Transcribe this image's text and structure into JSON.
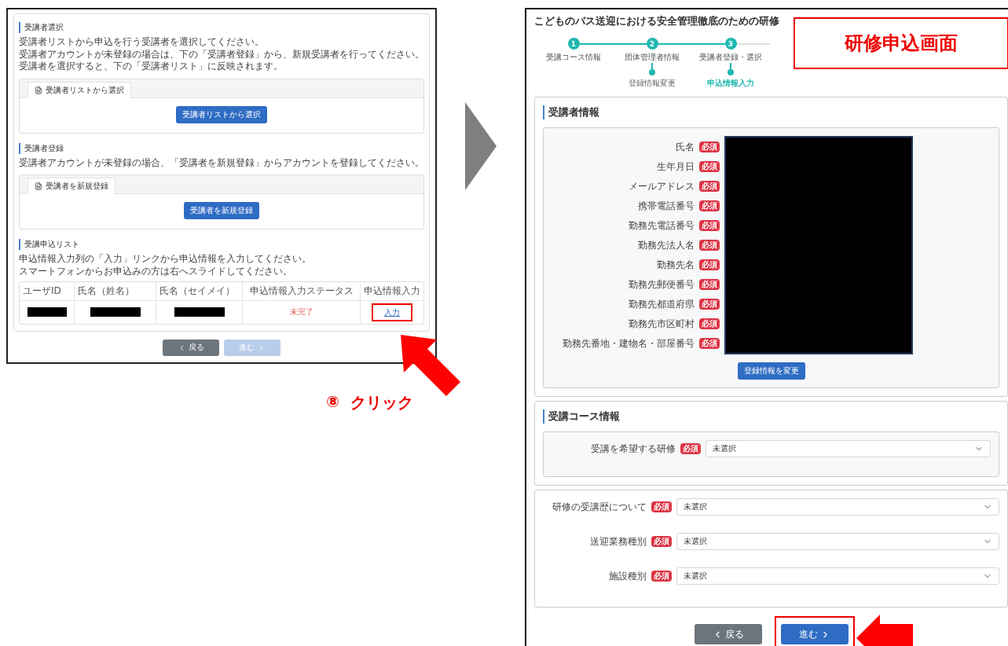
{
  "left_screen": {
    "sections": [
      {
        "heading": "受講者選択",
        "description": [
          "受講者リストから申込を行う受講者を選択してください。",
          "受講者アカウントが未登録の場合は、下の「受講者登録」から、新規受講者を行ってください。",
          "受講者を選択すると、下の「受講者リスト」に反映されます。"
        ],
        "tab": "受講者リストから選択",
        "button": "受講者リストから選択"
      },
      {
        "heading": "受講者登録",
        "description": [
          "受講者アカウントが未登録の場合、「受講者を新規登録」からアカウントを登録してください。"
        ],
        "tab": "受講者を新規登録",
        "button": "受講者を新規登録"
      }
    ],
    "list": {
      "heading": "受講申込リスト",
      "description": [
        "申込情報入力列の「入力」リンクから申込情報を入力してください。",
        "スマートフォンからお申込みの方は右へスライドしてください。"
      ],
      "columns": [
        "ユーザID",
        "氏名（姓名）",
        "氏名（セイメイ）",
        "申込情報入力ステータス",
        "申込情報入力"
      ],
      "rows": [
        {
          "status": "未完了",
          "link": "入力",
          "highlighted": true
        }
      ]
    },
    "buttons": [
      {
        "label": "戻る",
        "kind": "back",
        "disabled": false
      },
      {
        "label": "進む",
        "kind": "next",
        "disabled": true
      }
    ]
  },
  "annotation": {
    "step": "⑧",
    "action": "クリック"
  },
  "right_screen": {
    "title": "こどものバス送迎における安全管理徹底のための研修",
    "steps": [
      {
        "number": "1",
        "label": "受講コース情報",
        "done": true
      },
      {
        "number": "2",
        "label": "団体管理者情報",
        "done": true,
        "sub": {
          "label": "登録情報変更",
          "selected": false
        }
      },
      {
        "number": "3",
        "label": "受講者登録・選択",
        "done": true,
        "sub": {
          "label": "申込情報入力",
          "selected": true
        }
      }
    ],
    "caption": "研修申込画面",
    "applicant": {
      "heading": "受講者情報",
      "fields": [
        {
          "label": "氏名",
          "badge": "必須"
        },
        {
          "label": "生年月日",
          "badge": "必須"
        },
        {
          "label": "メールアドレス",
          "badge": "必須"
        },
        {
          "label": "携帯電話番号",
          "badge": "必須"
        },
        {
          "label": "勤務先電話番号",
          "badge": "必須"
        },
        {
          "label": "勤務先法人名",
          "badge": "必須"
        },
        {
          "label": "勤務先名",
          "badge": "必須"
        },
        {
          "label": "勤務先郵便番号",
          "badge": "必須"
        },
        {
          "label": "勤務先都道府県",
          "badge": "必須"
        },
        {
          "label": "勤務先市区町村",
          "badge": "必須"
        },
        {
          "label": "勤務先番地・建物名・部屋番号",
          "badge": "必須"
        }
      ],
      "button": "登録情報を変更"
    },
    "course": {
      "heading": "受講コース情報",
      "fields": [
        {
          "label": "受講を希望する研修",
          "badge": "必須",
          "value": "未選択"
        }
      ]
    },
    "other": {
      "fields": [
        {
          "label": "研修の受講歴について",
          "badge": "必須",
          "value": "未選択"
        },
        {
          "label": "送迎業務種別",
          "badge": "必須",
          "value": "未選択"
        },
        {
          "label": "施設種別",
          "badge": "必須",
          "value": "未選択"
        }
      ]
    },
    "buttons": [
      {
        "label": "戻る",
        "kind": "back",
        "highlighted": false
      },
      {
        "label": "進む",
        "kind": "next",
        "highlighted": true
      }
    ]
  }
}
